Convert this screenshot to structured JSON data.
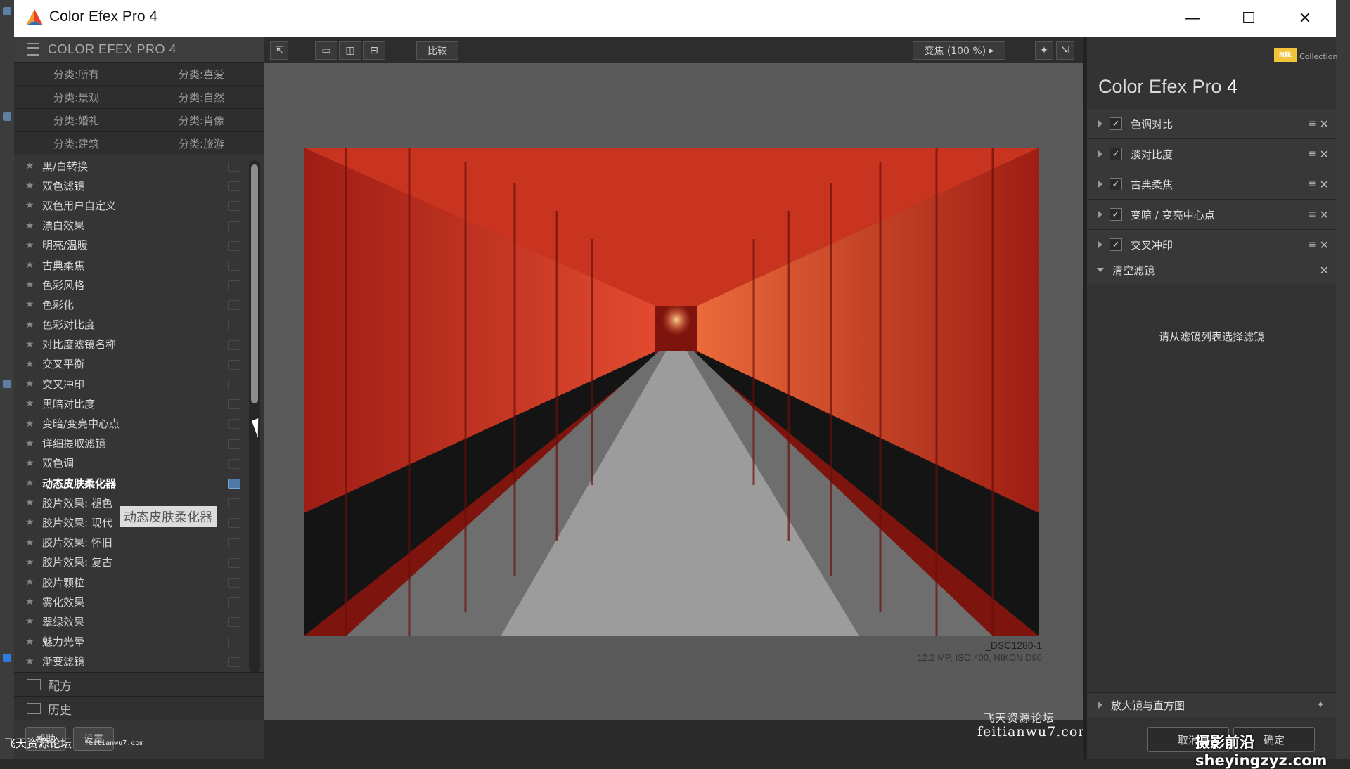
{
  "window": {
    "title": "Color Efex Pro 4",
    "minimize": "—",
    "maximize": "☐",
    "close": "✕"
  },
  "left_panel": {
    "header": "COLOR EFEX PRO 4",
    "categories": [
      "分类:所有",
      "分类:喜爱",
      "分类:景观",
      "分类:自然",
      "分类:婚礼",
      "分类:肖像",
      "分类:建筑",
      "分类:旅游"
    ],
    "filters": [
      "黑/白转换",
      "双色滤镜",
      "双色用户自定义",
      "漂白效果",
      "明亮/温暖",
      "古典柔焦",
      "色彩风格",
      "色彩化",
      "色彩对比度",
      "对比度滤镜名称",
      "交叉平衡",
      "交叉冲印",
      "黑暗对比度",
      "变暗/变亮中心点",
      "详细提取滤镜",
      "双色调",
      "动态皮肤柔化器",
      "胶片效果: 褪色",
      "胶片效果: 现代",
      "胶片效果: 怀旧",
      "胶片效果: 复古",
      "胶片颗粒",
      "雾化效果",
      "翠绿效果",
      "魅力光晕",
      "渐变滤镜"
    ],
    "active_filter_index": 16,
    "tooltip": "动态皮肤柔化器",
    "recipes_label": "配方",
    "history_label": "历史",
    "buttons": [
      "帮助",
      "设置"
    ]
  },
  "toolbar": {
    "compare_label": "比较",
    "zoom_label": "变焦 (100 %)"
  },
  "image": {
    "filename": "_DSC1280-1",
    "info": "12.2 MP, ISO 400, NIKON D90"
  },
  "watermark": {
    "line1": "飞天资源论坛",
    "line2": "feitianwu7.com"
  },
  "right_panel": {
    "brand": "Nik",
    "brand_sub": "Collection",
    "title_main": "Color Efex Pro",
    "title_num": "4",
    "stack": [
      {
        "name": "色调对比",
        "checked": true
      },
      {
        "name": "淡对比度",
        "checked": true
      },
      {
        "name": "古典柔焦",
        "checked": true
      },
      {
        "name": "变暗 / 变亮中心点",
        "checked": true
      },
      {
        "name": "交叉冲印",
        "checked": true
      }
    ],
    "empty_section": "清空滤镜",
    "hint": "请从滤镜列表选择滤镜",
    "loupe_label": "放大镜与直方图",
    "cancel_label": "取消",
    "ok_label": "确定"
  },
  "corner_watermarks": {
    "left": "飞天资源论坛",
    "left_url": "feitianwu7.com",
    "right": "摄影前沿sheyingzyz.com"
  },
  "colors": {
    "accent": "#4f78a9",
    "torii_red": "#c8261b",
    "nik_yellow": "#f2c43a"
  }
}
